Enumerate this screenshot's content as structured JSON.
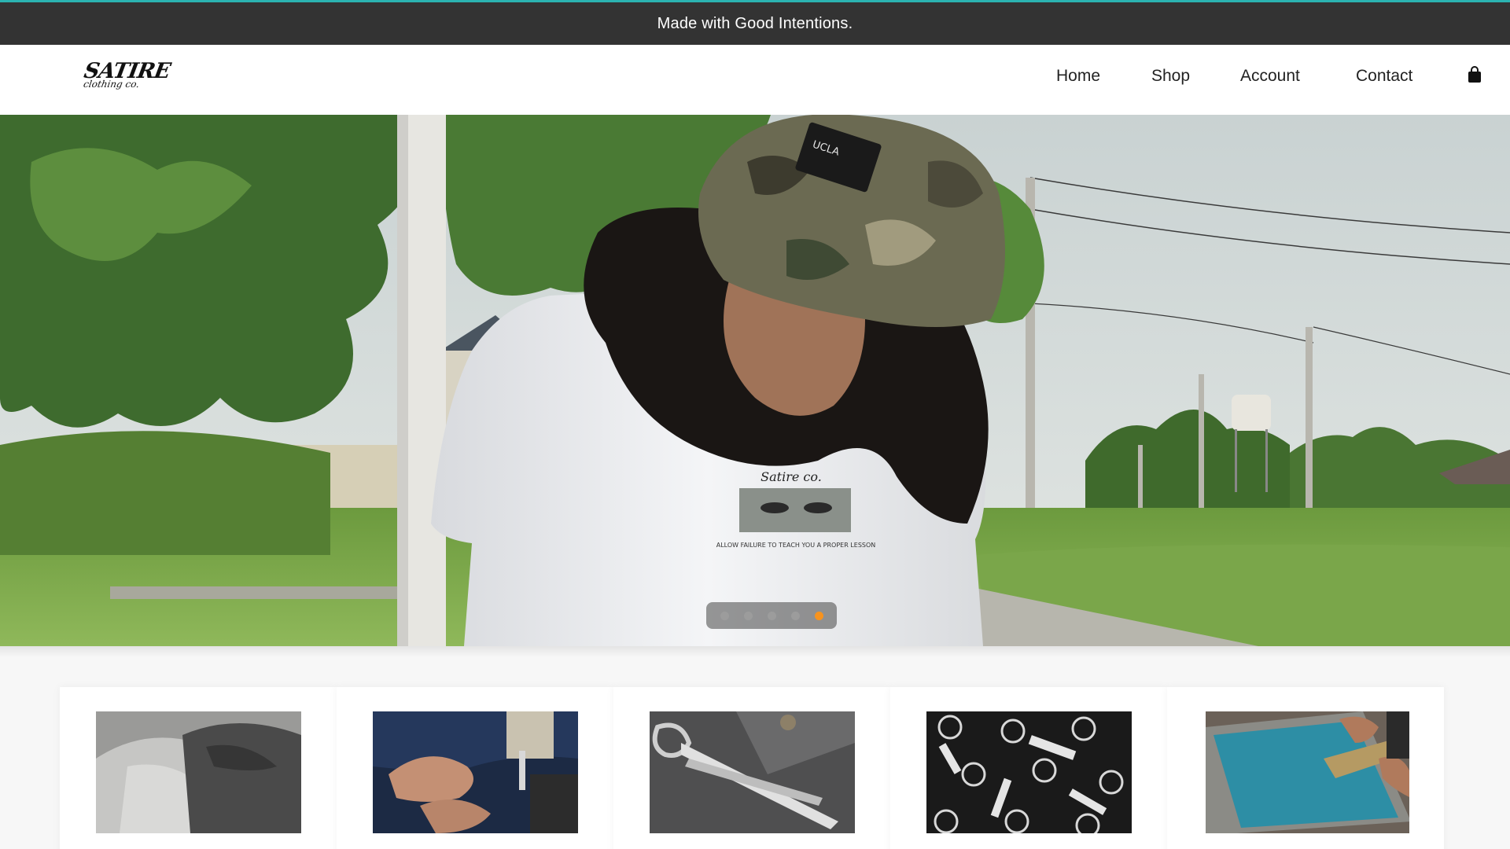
{
  "announcement": {
    "text": "Made with Good Intentions."
  },
  "brand": {
    "logo_text": "SATIRE",
    "logo_subtext": "clothing co."
  },
  "nav": {
    "items": [
      {
        "label": "Home"
      },
      {
        "label": "Shop"
      },
      {
        "label": "Account"
      },
      {
        "label": "Contact"
      }
    ],
    "cart_icon": "shopping-bag-icon"
  },
  "hero": {
    "slide_count": 5,
    "active_slide": 5,
    "shirt_print_text": "ALLOW FAILURE TO TEACH YOU A PROPER LESSON",
    "hat_label_text": "UCLA"
  },
  "categories": {
    "items": [
      {
        "image": "folded-tshirts"
      },
      {
        "image": "sewing-machine"
      },
      {
        "image": "fabric-scissors"
      },
      {
        "image": "satire-labels"
      },
      {
        "image": "screen-printing"
      }
    ]
  },
  "colors": {
    "announcement_bg": "#333333",
    "announcement_accent": "#2bb3b1",
    "active_dot": "#f7931e"
  }
}
